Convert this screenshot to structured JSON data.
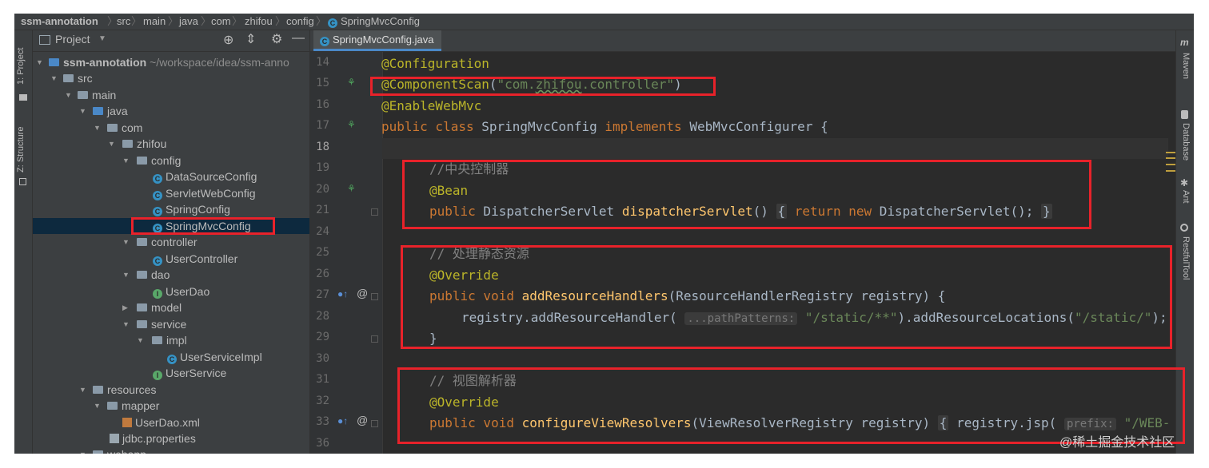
{
  "breadcrumbs": [
    "ssm-annotation",
    "src",
    "main",
    "java",
    "com",
    "zhifou",
    "config",
    "SpringMvcConfig"
  ],
  "left_strip": {
    "project_tab": "1: Project",
    "structure_tab": "Z: Structure"
  },
  "right_strip": {
    "maven": "Maven",
    "database": "Database",
    "ant": "Ant",
    "restfultool": "RestfulTool"
  },
  "project_panel": {
    "title": "Project",
    "tree": [
      {
        "label": "ssm-annotation",
        "path": "~/workspace/idea/ssm-anno"
      },
      {
        "label": "src"
      },
      {
        "label": "main"
      },
      {
        "label": "java"
      },
      {
        "label": "com"
      },
      {
        "label": "zhifou"
      },
      {
        "label": "config"
      },
      {
        "label": "DataSourceConfig"
      },
      {
        "label": "ServletWebConfig"
      },
      {
        "label": "SpringConfig"
      },
      {
        "label": "SpringMvcConfig"
      },
      {
        "label": "controller"
      },
      {
        "label": "UserController"
      },
      {
        "label": "dao"
      },
      {
        "label": "UserDao"
      },
      {
        "label": "model"
      },
      {
        "label": "service"
      },
      {
        "label": "impl"
      },
      {
        "label": "UserServiceImpl"
      },
      {
        "label": "UserService"
      },
      {
        "label": "resources"
      },
      {
        "label": "mapper"
      },
      {
        "label": "UserDao.xml"
      },
      {
        "label": "jdbc.properties"
      },
      {
        "label": "webapp"
      }
    ]
  },
  "editor_tab": {
    "label": "SpringMvcConfig.java",
    "close": "×"
  },
  "line_numbers": [
    "14",
    "15",
    "16",
    "17",
    "18",
    "19",
    "20",
    "21",
    "24",
    "25",
    "26",
    "27",
    "28",
    "29",
    "30",
    "31",
    "32",
    "33",
    "36"
  ],
  "code": {
    "l14": "@Configuration",
    "l15_ann": "@ComponentScan",
    "l15_open": "(",
    "l15_str_a": "\"com.",
    "l15_str_b": "zhifou",
    "l15_str_c": ".controller\"",
    "l15_close": ")",
    "l16": "@EnableWebMvc",
    "l17_kw": "public class",
    "l17_name": " SpringMvcConfig ",
    "l17_kw2": "implements",
    "l17_rest": " WebMvcConfigurer {",
    "l19": "//中央控制器",
    "l20": "@Bean",
    "l21_kw": "public",
    "l21_type": " DispatcherServlet ",
    "l21_fn": "dispatcherServlet",
    "l21_paren": "()",
    "l21_open": "{",
    "l21_kw2": " return new",
    "l21_rest": " DispatcherServlet();",
    "l21_close": "}",
    "l25": "// 处理静态资源",
    "l26": "@Override",
    "l27_kw": "public void",
    "l27_fn": "addResourceHandlers",
    "l27_rest": "(ResourceHandlerRegistry registry) {",
    "l28_a": "registry.addResourceHandler(",
    "l28_hint": "...pathPatterns:",
    "l28_str1": "\"/static/**\"",
    "l28_b": ").addResourceLocations(",
    "l28_str2": "\"/static/\"",
    "l28_c": ");",
    "l29": "}",
    "l31": "// 视图解析器",
    "l32": "@Override",
    "l33_kw": "public void",
    "l33_fn": "configureViewResolvers",
    "l33_rest": "(ViewResolverRegistry registry)",
    "l33_open": "{",
    "l33_b": " registry.jsp(",
    "l33_hint": "prefix:",
    "l33_str": "\"/WEB-"
  },
  "watermark": "@稀土掘金技术社区",
  "colors": {
    "highlight_box": "#e8222a",
    "annotation": "#bbb529",
    "keyword": "#cc7832",
    "string": "#6a8759",
    "method": "#ffc66d",
    "comment": "#808080"
  }
}
